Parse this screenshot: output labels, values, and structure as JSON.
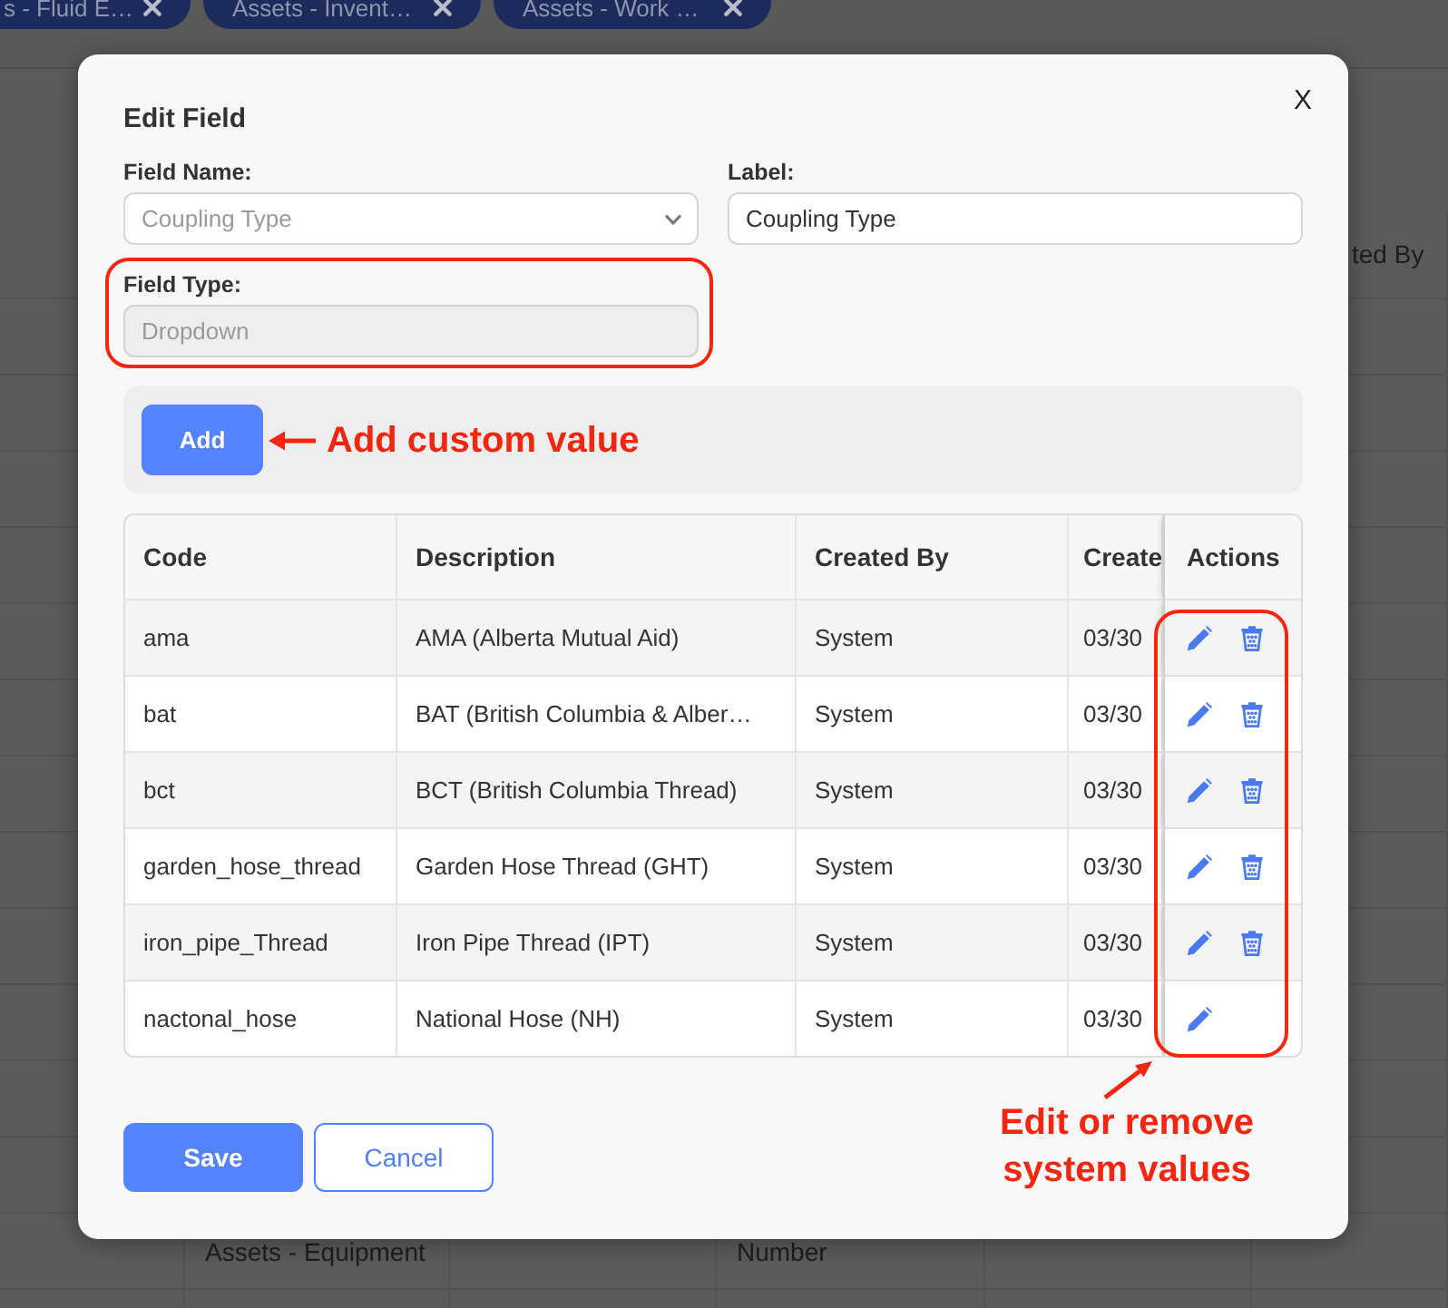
{
  "background": {
    "tabs": [
      {
        "label": "s - Fluid E…",
        "selected": false
      },
      {
        "label": "Assets - Invent…",
        "selected": false
      },
      {
        "label": "Assets - Work …",
        "selected": false
      }
    ],
    "table": {
      "header": {
        "column_6": "ted By"
      },
      "rows": [
        {
          "column_2": "Assets - Equipment",
          "column_4": "Number"
        }
      ]
    }
  },
  "dialog": {
    "title": "Edit Field",
    "close": "X",
    "fields": [
      {
        "label": "Field Name:",
        "kind": "select",
        "value": "Coupling Type",
        "disabled": true,
        "highlighted": false
      },
      {
        "label": "Label:",
        "kind": "text",
        "value": "Coupling Type",
        "disabled": false,
        "highlighted": false
      },
      {
        "label": "Field Type:",
        "kind": "text",
        "value": "Dropdown",
        "disabled": true,
        "highlighted": true
      }
    ],
    "add_button": "Add",
    "add_note": "Add custom value",
    "table": {
      "columns": [
        "Code",
        "Description",
        "Created By",
        "Create",
        "Actions"
      ],
      "actions_highlighted": true,
      "rows": [
        {
          "code": "ama",
          "description": "AMA (Alberta Mutual Aid)",
          "created_by": "System",
          "created": "03/30",
          "deletable": true
        },
        {
          "code": "bat",
          "description": "BAT (British Columbia & Alber…",
          "created_by": "System",
          "created": "03/30",
          "deletable": true
        },
        {
          "code": "bct",
          "description": "BCT (British Columbia Thread)",
          "created_by": "System",
          "created": "03/30",
          "deletable": true
        },
        {
          "code": "garden_hose_thread",
          "description": "Garden Hose Thread (GHT)",
          "created_by": "System",
          "created": "03/30",
          "deletable": true
        },
        {
          "code": "iron_pipe_Thread",
          "description": "Iron Pipe Thread (IPT)",
          "created_by": "System",
          "created": "03/30",
          "deletable": true
        },
        {
          "code": "nactonal_hose",
          "description": "National Hose (NH)",
          "created_by": "System",
          "created": "03/30",
          "deletable": false
        }
      ]
    },
    "buttons": [
      {
        "label": "Save",
        "kind": "primary"
      },
      {
        "label": "Cancel",
        "kind": "secondary"
      }
    ],
    "actions_note": "Edit or remove system values"
  }
}
